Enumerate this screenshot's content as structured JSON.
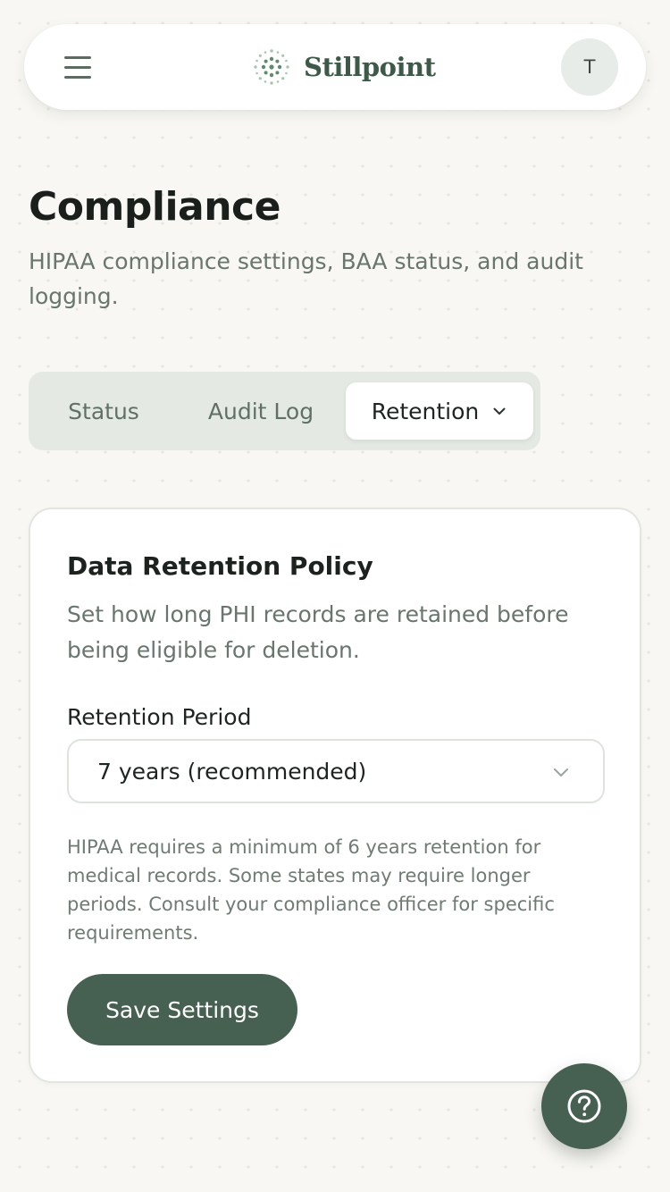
{
  "header": {
    "brand_name": "Stillpoint",
    "logo_icon": "dotted-circle-logo-icon",
    "menu_icon": "hamburger-menu-icon",
    "avatar_initial": "T"
  },
  "page": {
    "title": "Compliance",
    "subtitle": "HIPAA compliance settings, BAA status, and audit logging."
  },
  "tabs": [
    {
      "label": "Status",
      "active": false
    },
    {
      "label": "Audit Log",
      "active": false
    },
    {
      "label": "Retention",
      "active": true,
      "icon": "chevron-down-icon"
    }
  ],
  "retention_card": {
    "title": "Data Retention Policy",
    "description": "Set how long PHI records are retained before being eligible for deletion.",
    "field_label": "Retention Period",
    "selected_value": "7 years (recommended)",
    "hint": "HIPAA requires a minimum of 6 years retention for medical records. Some states may require longer periods. Consult your compliance officer for specific requirements.",
    "save_label": "Save Settings"
  },
  "help_button": {
    "icon": "help-question-icon"
  },
  "colors": {
    "brand": "#3d5a48",
    "primary_button": "#466052",
    "background": "#f8f7f3",
    "tab_track": "#e4e9e3"
  }
}
